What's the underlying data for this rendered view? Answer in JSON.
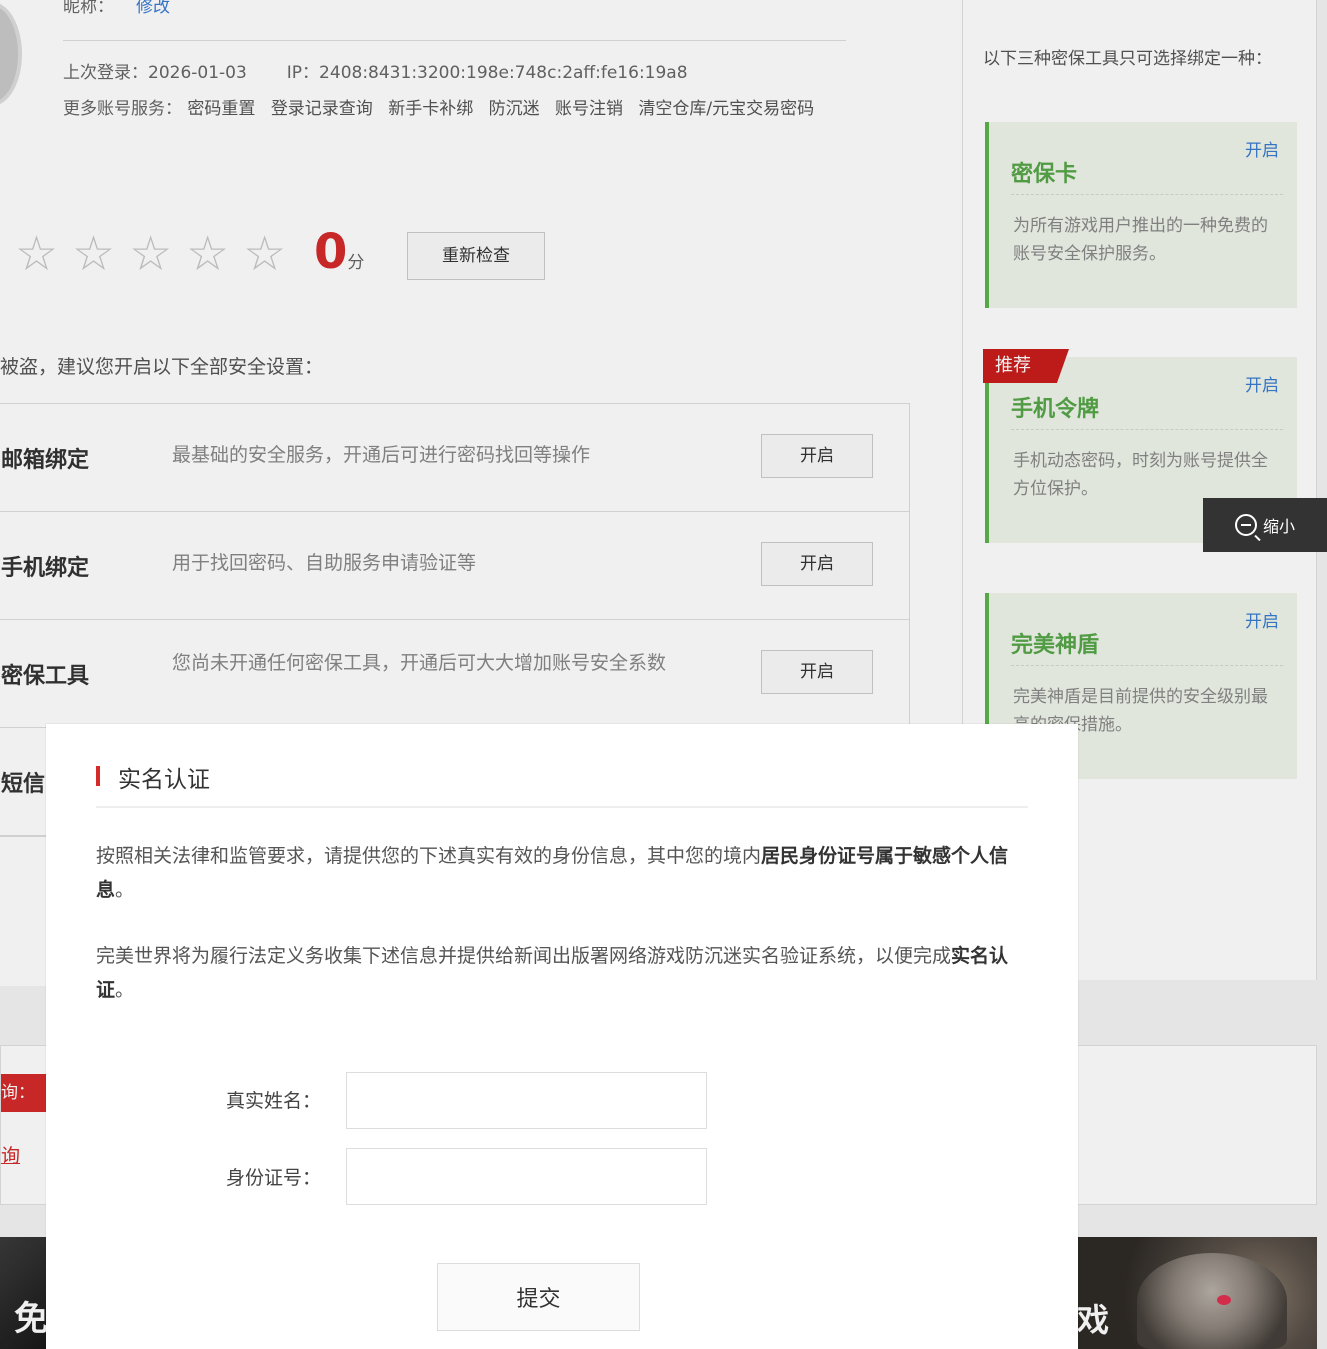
{
  "profile": {
    "nick_label": "昵称：",
    "nick_edit": "修改",
    "last_login": "上次登录：2026-01-03",
    "ip": "IP：2408:8431:3200:198e:748c:2aff:fe16:19a8",
    "services_label": "更多账号服务：",
    "services": [
      "密码重置",
      "登录记录查询",
      "新手卡补绑",
      "防沉迷",
      "账号注销",
      "清空仓库/元宝交易密码"
    ]
  },
  "security": {
    "stars_total": 5,
    "stars_filled": 0,
    "score": "0",
    "score_unit": "分",
    "recheck_label": "重新检查",
    "advice": "被盗，建议您开启以下全部安全设置：",
    "rows": [
      {
        "title": "邮箱绑定",
        "desc": "最基础的安全服务，开通后可进行密码找回等操作",
        "button": "开启"
      },
      {
        "title": "手机绑定",
        "desc": "用于找回密码、自助服务申请验证等",
        "button": "开启"
      },
      {
        "title": "密保工具",
        "desc": "您尚未开通任何密保工具，开通后可大大增加账号安全系数",
        "button": "开启"
      },
      {
        "title": "短信",
        "desc": "",
        "button": ""
      }
    ]
  },
  "tools": {
    "heading": "以下三种密保工具只可选择绑定一种：",
    "items": [
      {
        "name": "密保卡",
        "open": "开启",
        "desc": "为所有游戏用户推出的一种免费的账号安全保护服务。",
        "badge": ""
      },
      {
        "name": "手机令牌",
        "open": "开启",
        "desc": "手机动态密码，时刻为账号提供全方位保护。",
        "badge": "推荐"
      },
      {
        "name": "完美神盾",
        "open": "开启",
        "desc": "完美神盾是目前提供的安全级别最高的密保措施。",
        "badge": ""
      }
    ]
  },
  "zoom": {
    "label": "缩小",
    "icon": "zoom-out-icon"
  },
  "lower": {
    "tag": "询：",
    "link": "询"
  },
  "banners": {
    "left_char": "免",
    "right_char": "戏"
  },
  "modal": {
    "title": "实名认证",
    "p1_text": "按照相关法律和监管要求，请提供您的下述真实有效的身份信息，其中您的境内",
    "p1_bold": "居民身份证号属于敏感个人信息",
    "p1_end": "。",
    "p2_text": "完美世界将为履行法定义务收集下述信息并提供给新闻出版署网络游戏防沉迷实名验证系统，以便完成",
    "p2_bold": "实名认证",
    "p2_end": "。",
    "name_label": "真实姓名：",
    "name_value": "",
    "id_label": "身份证号：",
    "id_value": "",
    "submit": "提交"
  },
  "colors": {
    "accent_red": "#d42a2a",
    "tool_green": "#56a548",
    "link_blue": "#3a7cd0"
  }
}
